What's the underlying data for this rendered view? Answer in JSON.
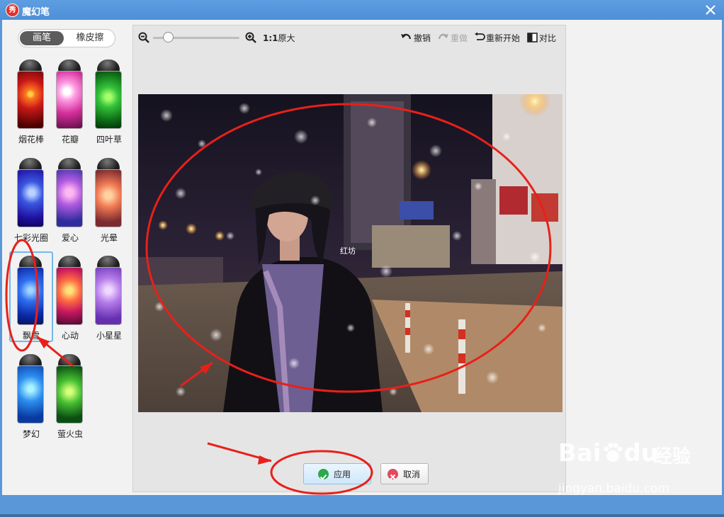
{
  "window": {
    "title": "魔幻笔",
    "logo_char": "秀"
  },
  "tabs": [
    {
      "label": "画笔",
      "active": true
    },
    {
      "label": "橡皮擦",
      "active": false
    }
  ],
  "brushes": [
    {
      "label": "烟花棒"
    },
    {
      "label": "花瓣"
    },
    {
      "label": "四叶草"
    },
    {
      "label": "七彩光圈"
    },
    {
      "label": "爱心"
    },
    {
      "label": "光晕"
    },
    {
      "label": "飘雪",
      "selected": true
    },
    {
      "label": "心动"
    },
    {
      "label": "小星星"
    },
    {
      "label": "梦幻"
    },
    {
      "label": "萤火虫"
    }
  ],
  "toolbar": {
    "zoom_ratio": "1:1",
    "original_size_label": "原大",
    "undo_label": "撤销",
    "redo_label": "重做",
    "restart_label": "重新开始",
    "compare_label": "对比"
  },
  "photo": {
    "sign_text": "红坊"
  },
  "actions": {
    "apply_label": "应用",
    "cancel_label": "取消"
  },
  "watermark": {
    "brand": "Bai",
    "brand2": "du",
    "cn": "经验",
    "url": "jingyan.baidu.com"
  },
  "colors": {
    "annotation": "#e8201a",
    "titlebar": "#5d9de0",
    "selection": "#72b8ec"
  }
}
